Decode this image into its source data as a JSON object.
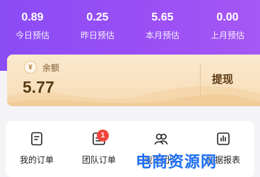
{
  "stats": [
    {
      "value": "0.89",
      "label": "今日预估"
    },
    {
      "value": "0.25",
      "label": "昨日预估"
    },
    {
      "value": "5.65",
      "label": "本月预估"
    },
    {
      "value": "0.00",
      "label": "上月预估"
    }
  ],
  "balance": {
    "label": "余额",
    "value": "5.77",
    "withdraw_label": "提现",
    "coin_glyph": "¥"
  },
  "menu": [
    {
      "label": "我的订单",
      "icon": "order-list-icon"
    },
    {
      "label": "团队订单",
      "icon": "team-order-icon",
      "badge": "1"
    },
    {
      "label": "我的团队",
      "icon": "team-icon"
    },
    {
      "label": "数据报表",
      "icon": "report-icon"
    }
  ],
  "watermark": "电商资源网",
  "colors": {
    "header": "#9b4ff5",
    "card": "#f7dcb5",
    "badge": "#f0463c",
    "watermark": "#1d6ff2"
  }
}
